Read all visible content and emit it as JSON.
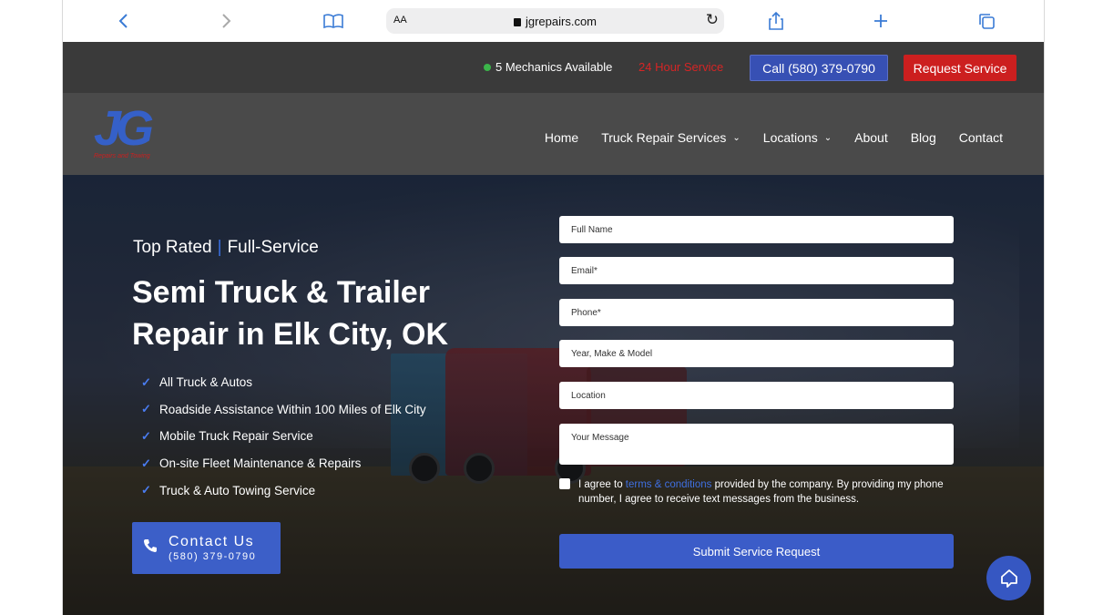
{
  "browser": {
    "aa_label": "AA",
    "url": "jgrepairs.com",
    "icons": [
      "back-icon",
      "forward-icon",
      "bookmarks-icon",
      "lock-icon",
      "reload-icon",
      "share-icon",
      "new-tab-icon",
      "tabs-icon"
    ]
  },
  "topbar": {
    "mechanics": "5 Mechanics Available",
    "service_24": "24 Hour Service",
    "call_button": "Call (580) 379-0790",
    "request_button": "Request Service"
  },
  "logo": {
    "letters": "JG",
    "tagline": "Repairs and Towing"
  },
  "nav": {
    "items": [
      {
        "label": "Home"
      },
      {
        "label": "Truck Repair Services"
      },
      {
        "label": "Locations"
      },
      {
        "label": "About"
      },
      {
        "label": "Blog"
      },
      {
        "label": "Contact"
      }
    ]
  },
  "hero": {
    "kicker_left": "Top Rated",
    "kicker_sep": "|",
    "kicker_right": "Full-Service",
    "title": "Semi Truck & Trailer Repair in Elk City, OK",
    "checklist": [
      "All Truck & Autos",
      "Roadside Assistance Within 100 Miles of Elk City",
      "Mobile Truck Repair Service",
      "On-site Fleet Maintenance & Repairs",
      "Truck & Auto Towing Service"
    ],
    "contact_label": "Contact Us",
    "contact_phone": "(580) 379-0790"
  },
  "form": {
    "full_name": "Full Name",
    "email": "Email*",
    "phone": "Phone*",
    "vehicle": "Year, Make & Model",
    "location": "Location",
    "message": "Your Message",
    "consent_pre": "I agree to ",
    "consent_link": "terms & conditions",
    "consent_post": " provided by the company. By providing my phone number, I agree to receive text messages from the business.",
    "submit": "Submit Service Request"
  },
  "colors": {
    "accent_blue": "#3750b4",
    "request_red": "#cc1f1f",
    "available_green": "#3bb54a",
    "service_red": "#d52525"
  }
}
